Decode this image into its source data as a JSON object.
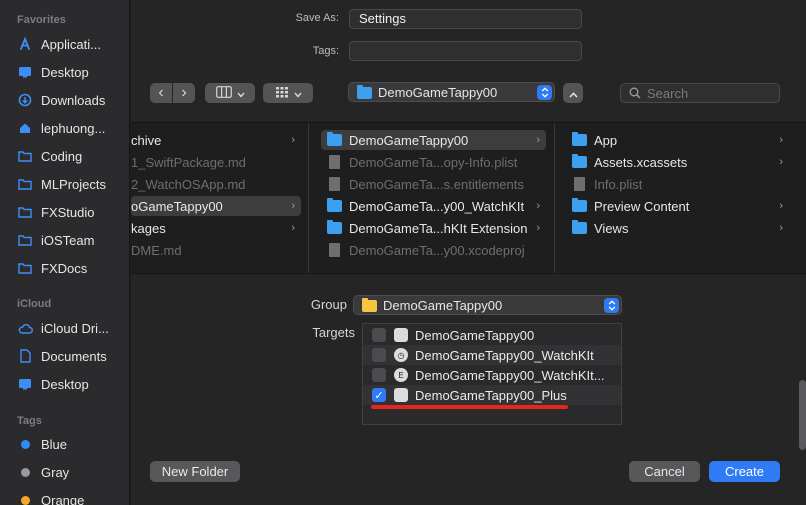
{
  "sidebar": {
    "favorites_title": "Favorites",
    "favorites": [
      {
        "label": "Applicati...",
        "icon": "applications-icon"
      },
      {
        "label": "Desktop",
        "icon": "desktop-icon"
      },
      {
        "label": "Downloads",
        "icon": "downloads-icon"
      },
      {
        "label": "lephuong...",
        "icon": "home-icon"
      },
      {
        "label": "Coding",
        "icon": "folder-icon"
      },
      {
        "label": "MLProjects",
        "icon": "folder-icon"
      },
      {
        "label": "FXStudio",
        "icon": "folder-icon"
      },
      {
        "label": "iOSTeam",
        "icon": "folder-icon"
      },
      {
        "label": "FXDocs",
        "icon": "folder-icon"
      }
    ],
    "icloud_title": "iCloud",
    "icloud": [
      {
        "label": "iCloud Dri...",
        "icon": "cloud-icon"
      },
      {
        "label": "Documents",
        "icon": "document-icon"
      },
      {
        "label": "Desktop",
        "icon": "desktop-icon"
      }
    ],
    "tags_title": "Tags",
    "tags": [
      {
        "label": "Blue",
        "color": "#2f8cf6"
      },
      {
        "label": "Gray",
        "color": "#9a9a9c"
      },
      {
        "label": "Orange",
        "color": "#f5a623"
      }
    ]
  },
  "form": {
    "save_as_label": "Save As:",
    "save_as_value": "Settings",
    "tags_label": "Tags:",
    "tags_value": ""
  },
  "toolbar": {
    "location": "DemoGameTappy00",
    "search_placeholder": "Search"
  },
  "browser": {
    "col1": [
      {
        "label": "chive",
        "chevron": true,
        "style": "bright"
      },
      {
        "label": "1_SwiftPackage.md",
        "chevron": false,
        "style": "dim"
      },
      {
        "label": "2_WatchOSApp.md",
        "chevron": false,
        "style": "dim"
      },
      {
        "label": "oGameTappy00",
        "chevron": true,
        "style": "bright"
      },
      {
        "label": "kages",
        "chevron": true,
        "style": "bright"
      },
      {
        "label": "DME.md",
        "chevron": false,
        "style": "dim"
      }
    ],
    "col2": [
      {
        "label": "DemoGameTappy00",
        "chevron": true,
        "style": "bright",
        "icon": "folder"
      },
      {
        "label": "DemoGameTa...opy-Info.plist",
        "chevron": false,
        "style": "dim",
        "icon": "doc"
      },
      {
        "label": "DemoGameTa...s.entitlements",
        "chevron": false,
        "style": "dim",
        "icon": "doc"
      },
      {
        "label": "DemoGameTa...y00_WatchKIt",
        "chevron": true,
        "style": "bright",
        "icon": "folder"
      },
      {
        "label": "DemoGameTa...hKIt Extension",
        "chevron": true,
        "style": "bright",
        "icon": "folder"
      },
      {
        "label": "DemoGameTa...y00.xcodeproj",
        "chevron": false,
        "style": "dim",
        "icon": "doc"
      }
    ],
    "col3": [
      {
        "label": "App",
        "chevron": true,
        "style": "bright",
        "icon": "folder"
      },
      {
        "label": "Assets.xcassets",
        "chevron": true,
        "style": "bright",
        "icon": "folder"
      },
      {
        "label": "Info.plist",
        "chevron": false,
        "style": "dim",
        "icon": "doc"
      },
      {
        "label": "Preview Content",
        "chevron": true,
        "style": "bright",
        "icon": "folder"
      },
      {
        "label": "Views",
        "chevron": true,
        "style": "bright",
        "icon": "folder"
      }
    ]
  },
  "group": {
    "label": "Group",
    "value": "DemoGameTappy00"
  },
  "targets": {
    "label": "Targets",
    "items": [
      {
        "label": "DemoGameTappy00",
        "checked": false,
        "icon": "app-icon"
      },
      {
        "label": "DemoGameTappy00_WatchKIt",
        "checked": false,
        "icon": "watch-icon"
      },
      {
        "label": "DemoGameTappy00_WatchKIt...",
        "checked": false,
        "icon": "extension-icon"
      },
      {
        "label": "DemoGameTappy00_Plus",
        "checked": true,
        "icon": "app-icon"
      }
    ]
  },
  "buttons": {
    "new_folder": "New Folder",
    "cancel": "Cancel",
    "create": "Create"
  },
  "glyphs": {
    "check": "✓",
    "chev_right": "›",
    "chev_left": "‹",
    "updown": "⌃⌄",
    "watch_glyph": "◷",
    "ext_glyph": "E"
  }
}
